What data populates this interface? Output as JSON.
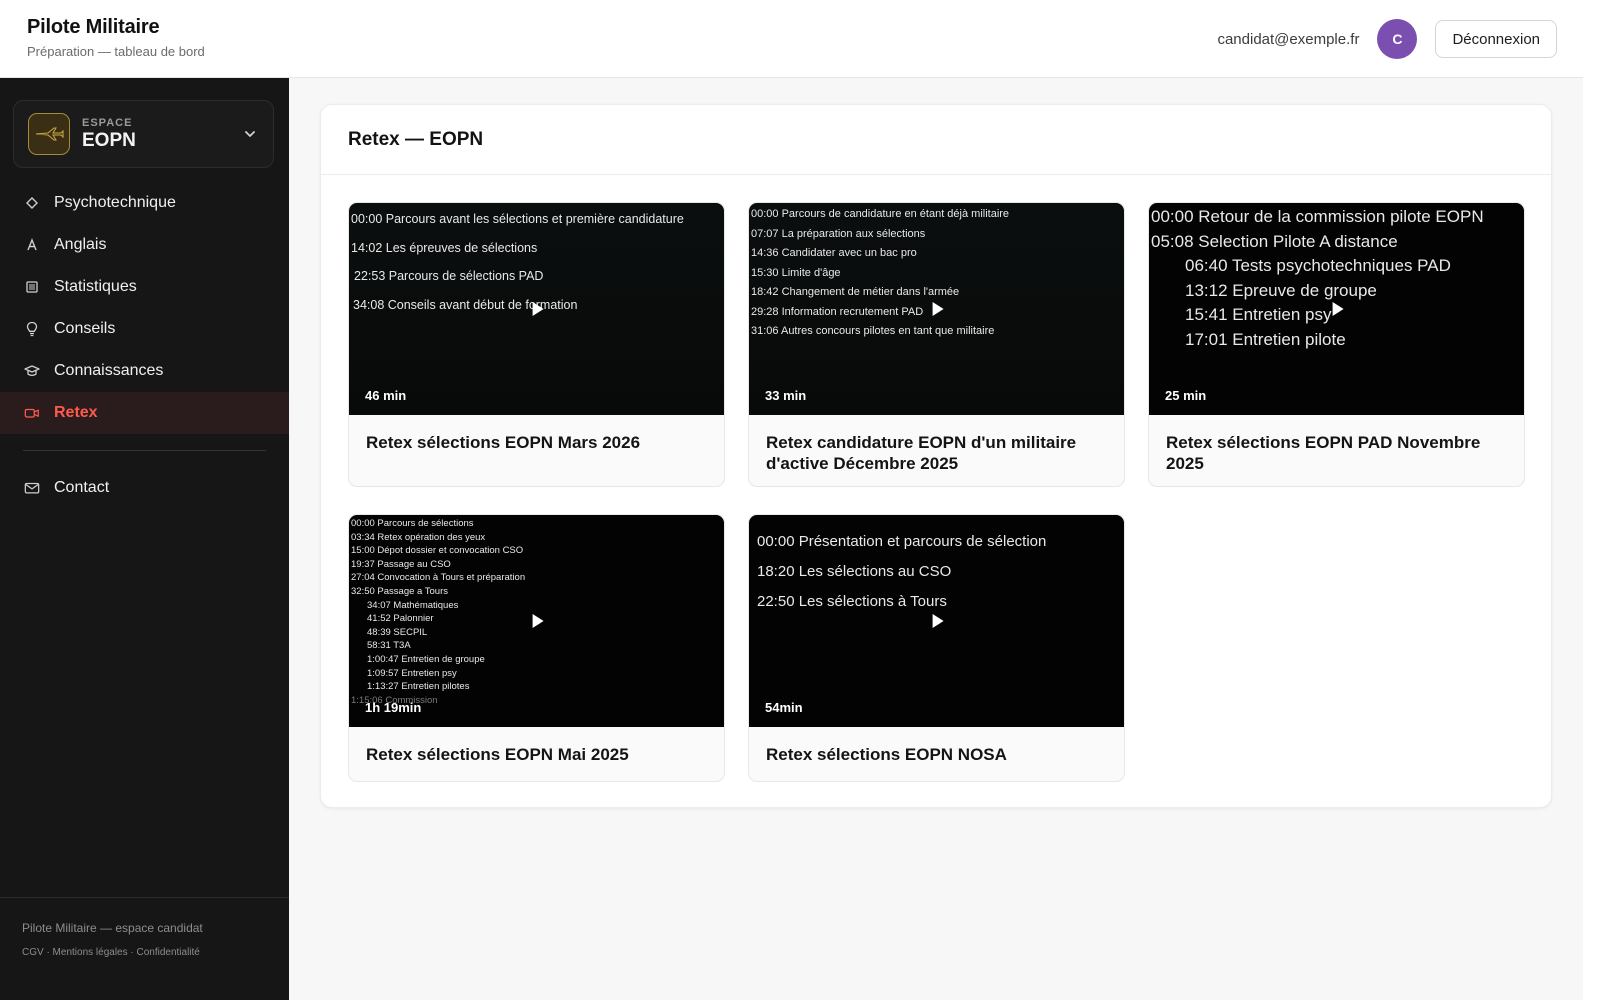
{
  "header": {
    "brand_title": "Pilote Militaire",
    "brand_subtitle": "Préparation — tableau de bord",
    "user_email": "candidat@exemple.fr",
    "avatar_initial": "C",
    "logout_label": "Déconnexion"
  },
  "sidebar": {
    "space_kicker": "ESPACE",
    "space_name": "EOPN",
    "items": [
      {
        "label": "Psychotechnique",
        "icon": "diamond-icon"
      },
      {
        "label": "Anglais",
        "icon": "letter-a-icon"
      },
      {
        "label": "Statistiques",
        "icon": "list-icon"
      },
      {
        "label": "Conseils",
        "icon": "lightbulb-icon"
      },
      {
        "label": "Connaissances",
        "icon": "graduation-cap-icon"
      },
      {
        "label": "Retex",
        "icon": "video-camera-icon",
        "active": true
      }
    ],
    "contact_label": "Contact",
    "footer_title": "Pilote Militaire — espace candidat",
    "footer_links": "CGV · Mentions légales · Confidentialité"
  },
  "main": {
    "title": "Retex — EOPN",
    "videos": [
      {
        "title": "Retex sélections EOPN Mars 2026",
        "duration": "46 min",
        "chapters": [
          "00:00 Parcours avant les sélections et première candidature",
          "14:02 Les épreuves de sélections",
          "22:53 Parcours de sélections PAD",
          "34:08 Conseils avant début de formation"
        ]
      },
      {
        "title": "Retex candidature EOPN d'un militaire d'active Décembre 2025",
        "duration": "33 min",
        "chapters": [
          "00:00 Parcours de candidature en étant déjà militaire",
          "07:07 La préparation aux sélections",
          "14:36 Candidater avec un bac pro",
          "15:30 Limite d'âge",
          "18:42 Changement de métier dans l'armée",
          "29:28 Information recrutement PAD",
          "31:06 Autres concours pilotes en tant que militaire"
        ]
      },
      {
        "title": "Retex sélections EOPN PAD Novembre 2025",
        "duration": "25 min",
        "chapters": [
          "00:00 Retour de la commission pilote EOPN",
          "05:08 Selection Pilote A distance",
          "06:40 Tests psychotechniques PAD",
          "13:12 Epreuve de groupe",
          "15:41 Entretien psy",
          "17:01 Entretien pilote"
        ]
      },
      {
        "title": "Retex sélections EOPN Mai 2025",
        "duration": "1h 19min",
        "chapters": [
          "00:00 Parcours de sélections",
          "03:34 Retex opération des yeux",
          "15:00 Dépot dossier et convocation CSO",
          "19:37 Passage au CSO",
          "27:04 Convocation à Tours et préparation",
          "32:50 Passage a Tours",
          "34:07 Mathématiques",
          "41:52 Palonnier",
          "48:39 SECPIL",
          "58:31 T3A",
          "1:00:47 Entretien de groupe",
          "1:09:57 Entretien psy",
          "1:13:27 Entretien pilotes",
          "1:15:06 Commission"
        ]
      },
      {
        "title": "Retex sélections EOPN NOSA",
        "duration": "54min",
        "chapters": [
          "00:00 Présentation et parcours de sélection",
          "18:20 Les sélections au CSO",
          "22:50 Les sélections à Tours"
        ]
      }
    ]
  },
  "colors": {
    "accent": "#ff5a4d",
    "sidebar_bg": "#161616",
    "avatar": "#7a4fb0"
  }
}
